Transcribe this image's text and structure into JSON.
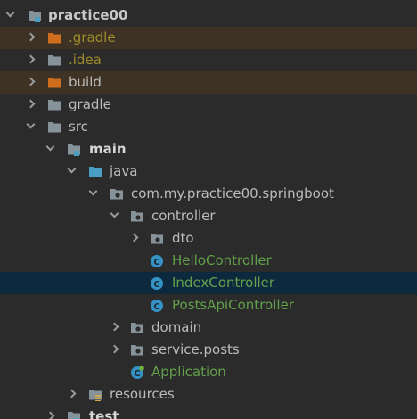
{
  "project_tree": {
    "items": [
      {
        "label": "practice00",
        "expanded": true,
        "icon": "module-folder-icon",
        "color": "#c8c8c8"
      },
      {
        "label": ".gradle",
        "expanded": false,
        "icon": "excluded-folder-icon",
        "color": "#9c8c2c",
        "excluded": true
      },
      {
        "label": ".idea",
        "expanded": false,
        "icon": "folder-icon",
        "color": "#9c8c2c"
      },
      {
        "label": "build",
        "expanded": false,
        "icon": "excluded-folder-icon",
        "color": "#bbbbbb",
        "excluded": true
      },
      {
        "label": "gradle",
        "expanded": false,
        "icon": "folder-icon",
        "color": "#bbbbbb"
      },
      {
        "label": "src",
        "expanded": true,
        "icon": "folder-icon",
        "color": "#bbbbbb"
      },
      {
        "label": "main",
        "expanded": true,
        "icon": "module-folder-icon",
        "color": "#d6d6d6"
      },
      {
        "label": "java",
        "expanded": true,
        "icon": "source-root-folder-icon",
        "color": "#bbbbbb"
      },
      {
        "label": "com.my.practice00.springboot",
        "expanded": true,
        "icon": "package-icon",
        "color": "#bbbbbb"
      },
      {
        "label": "controller",
        "expanded": true,
        "icon": "package-icon",
        "color": "#bbbbbb"
      },
      {
        "label": "dto",
        "expanded": false,
        "icon": "package-icon",
        "color": "#bbbbbb"
      },
      {
        "label": "HelloController",
        "icon": "java-class-icon",
        "color": "#62a04b"
      },
      {
        "label": "IndexController",
        "icon": "java-class-icon",
        "color": "#62a04b",
        "selected": true
      },
      {
        "label": "PostsApiController",
        "icon": "java-class-icon",
        "color": "#62a04b"
      },
      {
        "label": "domain",
        "expanded": false,
        "icon": "package-icon",
        "color": "#bbbbbb"
      },
      {
        "label": "service.posts",
        "expanded": false,
        "icon": "package-icon",
        "color": "#bbbbbb"
      },
      {
        "label": "Application",
        "icon": "spring-boot-class-icon",
        "color": "#62a04b"
      },
      {
        "label": "resources",
        "expanded": false,
        "icon": "resources-folder-icon",
        "color": "#bbbbbb"
      },
      {
        "label": "test",
        "expanded": false,
        "icon": "module-folder-icon",
        "color": "#d6d6d6"
      }
    ]
  },
  "colors": {
    "background": "#2b2b2b",
    "selected_row": "#0d293e",
    "excluded_row": "#3d3223",
    "folder": "#87939a",
    "excluded_folder": "#d06e1e",
    "source_root": "#4a9ec4",
    "class_icon": "#3592c4"
  }
}
